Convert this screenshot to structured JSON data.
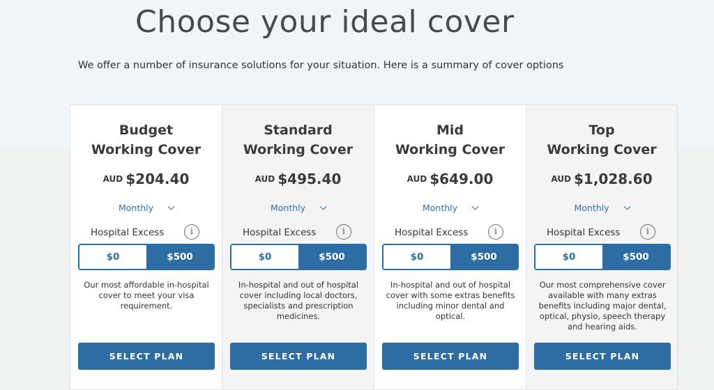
{
  "header": {
    "title": "Choose your ideal cover",
    "subtitle": "We offer a number of insurance solutions for your situation. Here is a summary of cover options"
  },
  "plans": [
    {
      "title_line1": "Budget",
      "title_line2": "Working Cover",
      "currency": "AUD",
      "price": "$204.40",
      "frequency": "Monthly",
      "excess_label": "Hospital Excess",
      "excess_options": [
        "$0",
        "$500"
      ],
      "excess_selected": "$500",
      "description": "Our most affordable in-hospital cover to meet your visa requirement.",
      "button": "SELECT PLAN"
    },
    {
      "title_line1": "Standard",
      "title_line2": "Working Cover",
      "currency": "AUD",
      "price": "$495.40",
      "frequency": "Monthly",
      "excess_label": "Hospital Excess",
      "excess_options": [
        "$0",
        "$500"
      ],
      "excess_selected": "$500",
      "description": "In-hospital and out of hospital cover including local doctors, specialists and prescription medicines.",
      "button": "SELECT PLAN"
    },
    {
      "title_line1": "Mid",
      "title_line2": "Working Cover",
      "currency": "AUD",
      "price": "$649.00",
      "frequency": "Monthly",
      "excess_label": "Hospital Excess",
      "excess_options": [
        "$0",
        "$500"
      ],
      "excess_selected": "$500",
      "description": "In-hospital and out of hospital cover with some extras benefits including minor dental and optical.",
      "button": "SELECT PLAN"
    },
    {
      "title_line1": "Top",
      "title_line2": "Working Cover",
      "currency": "AUD",
      "price": "$1,028.60",
      "frequency": "Monthly",
      "excess_label": "Hospital Excess",
      "excess_options": [
        "$0",
        "$500"
      ],
      "excess_selected": "$500",
      "description": "Our most comprehensive cover available with many extras benefits including major dental, optical, physio, speech therapy and hearing aids.",
      "button": "SELECT PLAN"
    }
  ],
  "colors": {
    "primary": "#2e6da4",
    "link": "#2d6fa6",
    "heading": "#4a4a4a",
    "top_background": "#eff5f9",
    "bottom_background": "#eef3ef"
  },
  "icons": {
    "info": "info-icon",
    "dropdown": "chevron-down-icon"
  }
}
